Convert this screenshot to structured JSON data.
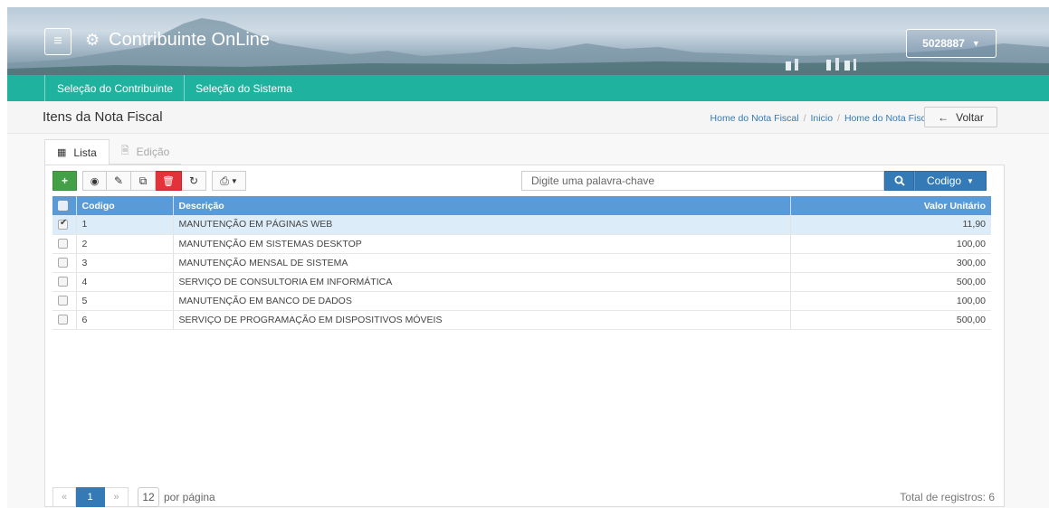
{
  "header": {
    "app_title": "Contribuinte OnLine",
    "user_id": "5028887",
    "menu_icon": "hamburger-icon",
    "gear_icon": "gear-icon"
  },
  "nav": {
    "items": [
      "Seleção do Contribuinte",
      "Seleção do Sistema"
    ]
  },
  "page": {
    "title": "Itens da Nota Fiscal",
    "breadcrumb": [
      "Home do Nota Fiscal",
      "Inicio",
      "Home do Nota Fiscal"
    ],
    "back_label": "Voltar"
  },
  "tabs": [
    {
      "label": "Lista",
      "active": true
    },
    {
      "label": "Edição",
      "active": false
    }
  ],
  "toolbar": {
    "add_label": "+",
    "search_placeholder": "Digite uma palavra-chave",
    "search_field_label": "Codigo"
  },
  "table": {
    "columns": [
      "Codigo",
      "Descrição",
      "Valor Unitário"
    ],
    "rows": [
      {
        "codigo": "1",
        "descricao": "MANUTENÇÃO EM PÁGINAS WEB",
        "valor": "11,90",
        "checked": true
      },
      {
        "codigo": "2",
        "descricao": "MANUTENÇÃO EM SISTEMAS DESKTOP",
        "valor": "100,00",
        "checked": false
      },
      {
        "codigo": "3",
        "descricao": "MANUTENÇÃO MENSAL DE SISTEMA",
        "valor": "300,00",
        "checked": false
      },
      {
        "codigo": "4",
        "descricao": "SERVIÇO DE CONSULTORIA EM INFORMÁTICA",
        "valor": "500,00",
        "checked": false
      },
      {
        "codigo": "5",
        "descricao": "MANUTENÇÃO EM BANCO DE DADOS",
        "valor": "100,00",
        "checked": false
      },
      {
        "codigo": "6",
        "descricao": "SERVIÇO DE PROGRAMAÇÃO EM DISPOSITIVOS MÓVEIS",
        "valor": "500,00",
        "checked": false
      }
    ]
  },
  "pagination": {
    "prev": "«",
    "current": "1",
    "next": "»",
    "per_page": "12",
    "per_page_label": "por página",
    "total_label": "Total de registros: 6"
  },
  "colors": {
    "nav": "#1fb39f",
    "primary": "#337ab7",
    "table_header": "#5a9ad6",
    "add": "#43a047",
    "delete": "#e2333a"
  }
}
